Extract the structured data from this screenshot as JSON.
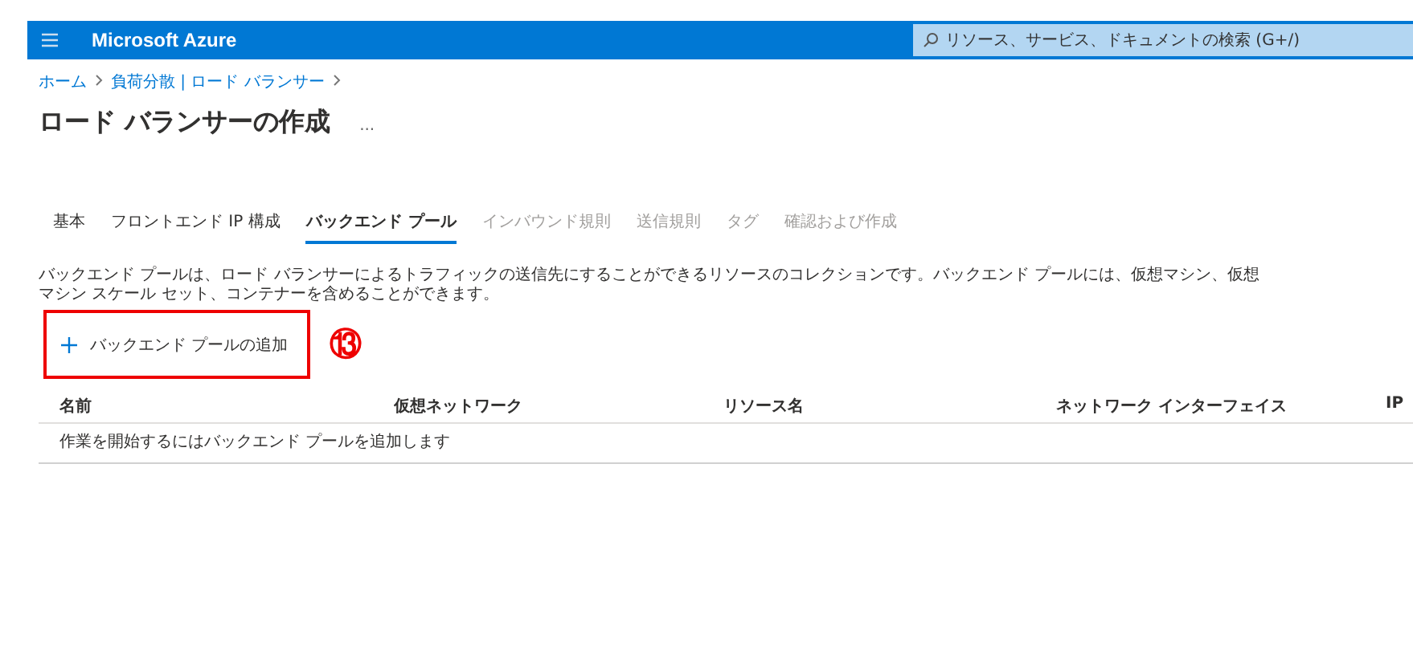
{
  "header": {
    "brand": "Microsoft Azure",
    "search": {
      "placeholder": "リソース、サービス、ドキュメントの検索 (G+/)"
    }
  },
  "breadcrumb": [
    "ホーム",
    "負荷分散 | ロード バランサー"
  ],
  "title": "ロード バランサーの作成",
  "more": "...",
  "tabs": [
    {
      "label": "基本",
      "selected": false,
      "disabled": false
    },
    {
      "label": "フロントエンド IP 構成",
      "selected": false,
      "disabled": false
    },
    {
      "label": "バックエンド プール",
      "selected": true,
      "disabled": false
    },
    {
      "label": "インバウンド規則",
      "selected": false,
      "disabled": true
    },
    {
      "label": "送信規則",
      "selected": false,
      "disabled": true
    },
    {
      "label": "タグ",
      "selected": false,
      "disabled": true
    },
    {
      "label": "確認および作成",
      "selected": false,
      "disabled": true
    }
  ],
  "description": "バックエンド プールは、ロード バランサーによるトラフィックの送信先にすることができるリソースのコレクションです。バックエンド プールには、仮想マシン、仮想マシン スケール セット、コンテナーを含めることができます。",
  "add_button": {
    "label": "バックエンド プールの追加"
  },
  "annotation": {
    "label": "⑬"
  },
  "table": {
    "columns": [
      "名前",
      "仮想ネットワーク",
      "リソース名",
      "ネットワーク インターフェイス",
      "IP"
    ],
    "empty_message": "作業を開始するにはバックエンド プールを追加します"
  }
}
